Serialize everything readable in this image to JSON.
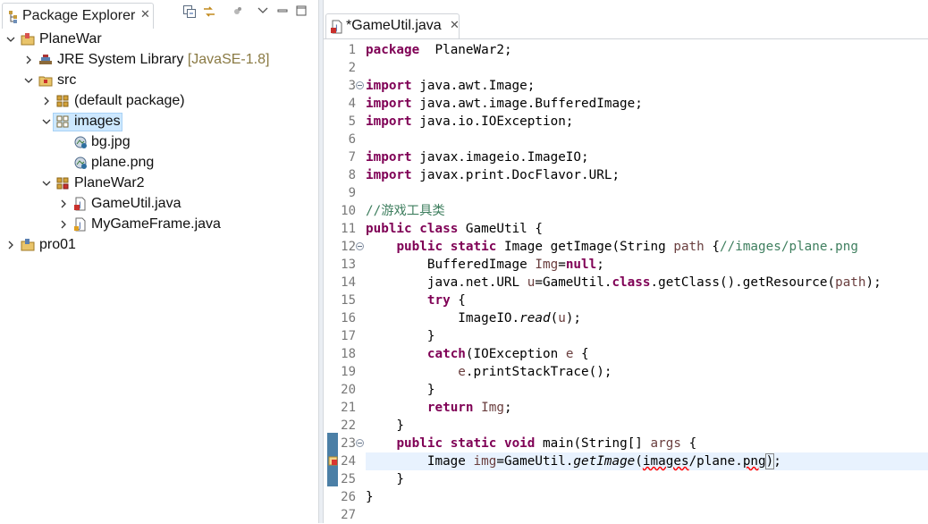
{
  "explorer": {
    "title": "Package Explorer",
    "tree": [
      {
        "label": "PlaneWar",
        "decoration": "",
        "icon": "project-icon",
        "expanded": true
      },
      {
        "label": "JRE System Library",
        "decoration": "[JavaSE-1.8]",
        "icon": "library-icon",
        "expanded": false
      },
      {
        "label": "src",
        "decoration": "",
        "icon": "source-folder-icon",
        "expanded": true
      },
      {
        "label": "(default package)",
        "decoration": "",
        "icon": "package-icon",
        "expanded": false
      },
      {
        "label": "images",
        "decoration": "",
        "icon": "package-icon",
        "expanded": true,
        "selected": true
      },
      {
        "label": "bg.jpg",
        "decoration": "",
        "icon": "image-file-icon"
      },
      {
        "label": "plane.png",
        "decoration": "",
        "icon": "image-file-icon"
      },
      {
        "label": "PlaneWar2",
        "decoration": "",
        "icon": "package-icon",
        "expanded": true
      },
      {
        "label": "GameUtil.java",
        "decoration": "",
        "icon": "java-file-icon",
        "expanded": false
      },
      {
        "label": "MyGameFrame.java",
        "decoration": "",
        "icon": "java-file-icon",
        "expanded": false
      },
      {
        "label": "pro01",
        "decoration": "",
        "icon": "project-icon",
        "expanded": false
      }
    ]
  },
  "editor": {
    "tab_title": "*GameUtil.java",
    "current_line": 24,
    "lines": [
      {
        "n": "1",
        "tokens": [
          [
            "kw",
            "package"
          ],
          [
            "",
            "  PlaneWar2;"
          ]
        ]
      },
      {
        "n": "2",
        "tokens": []
      },
      {
        "n": "3",
        "tokens": [
          [
            "kw",
            "import"
          ],
          [
            "",
            " java.awt.Image;"
          ]
        ]
      },
      {
        "n": "4",
        "tokens": [
          [
            "kw",
            "import"
          ],
          [
            "",
            " java.awt.image.BufferedImage;"
          ]
        ]
      },
      {
        "n": "5",
        "tokens": [
          [
            "kw",
            "import"
          ],
          [
            "",
            " java.io.IOException;"
          ]
        ]
      },
      {
        "n": "6",
        "tokens": []
      },
      {
        "n": "7",
        "tokens": [
          [
            "kw",
            "import"
          ],
          [
            "",
            " javax.imageio.ImageIO;"
          ]
        ]
      },
      {
        "n": "8",
        "tokens": [
          [
            "kw",
            "import"
          ],
          [
            "",
            " javax.print.DocFlavor.URL;"
          ]
        ]
      },
      {
        "n": "9",
        "tokens": []
      },
      {
        "n": "10",
        "tokens": [
          [
            "cm",
            "//游戏工具类"
          ]
        ]
      },
      {
        "n": "11",
        "tokens": [
          [
            "kw",
            "public"
          ],
          [
            "",
            " "
          ],
          [
            "kw",
            "class"
          ],
          [
            "",
            " GameUtil {"
          ]
        ]
      },
      {
        "n": "12",
        "tokens": [
          [
            "",
            "    "
          ],
          [
            "kw",
            "public"
          ],
          [
            "",
            " "
          ],
          [
            "kw",
            "static"
          ],
          [
            "",
            " Image getImage(String "
          ],
          [
            "pv",
            "path"
          ],
          [
            "",
            " {"
          ],
          [
            "cm",
            "//images/plane.png"
          ]
        ]
      },
      {
        "n": "13",
        "tokens": [
          [
            "",
            "        BufferedImage "
          ],
          [
            "pv",
            "Img"
          ],
          [
            "",
            "="
          ],
          [
            "kw",
            "null"
          ],
          [
            "",
            ";"
          ]
        ]
      },
      {
        "n": "14",
        "tokens": [
          [
            "",
            "        java.net.URL "
          ],
          [
            "pv",
            "u"
          ],
          [
            "",
            "=GameUtil."
          ],
          [
            "kw",
            "class"
          ],
          [
            "",
            ".getClass().getResource("
          ],
          [
            "pv",
            "path"
          ],
          [
            "",
            ");"
          ]
        ]
      },
      {
        "n": "15",
        "tokens": [
          [
            "",
            "        "
          ],
          [
            "kw",
            "try"
          ],
          [
            "",
            " {"
          ]
        ]
      },
      {
        "n": "16",
        "tokens": [
          [
            "",
            "            ImageIO."
          ],
          [
            "it",
            "read"
          ],
          [
            "",
            "("
          ],
          [
            "pv",
            "u"
          ],
          [
            "",
            ");"
          ]
        ]
      },
      {
        "n": "17",
        "tokens": [
          [
            "",
            "        }"
          ]
        ]
      },
      {
        "n": "18",
        "tokens": [
          [
            "",
            "        "
          ],
          [
            "kw",
            "catch"
          ],
          [
            "",
            "(IOException "
          ],
          [
            "pv",
            "e"
          ],
          [
            "",
            " {"
          ]
        ]
      },
      {
        "n": "19",
        "tokens": [
          [
            "",
            "            "
          ],
          [
            "pv",
            "e"
          ],
          [
            "",
            ".printStackTrace();"
          ]
        ]
      },
      {
        "n": "20",
        "tokens": [
          [
            "",
            "        }"
          ]
        ]
      },
      {
        "n": "21",
        "tokens": [
          [
            "",
            "        "
          ],
          [
            "kw",
            "return"
          ],
          [
            "",
            " "
          ],
          [
            "pv",
            "Img"
          ],
          [
            "",
            ";"
          ]
        ]
      },
      {
        "n": "22",
        "tokens": [
          [
            "",
            "    }"
          ]
        ]
      },
      {
        "n": "23",
        "tokens": [
          [
            "",
            "    "
          ],
          [
            "kw",
            "public"
          ],
          [
            "",
            " "
          ],
          [
            "kw",
            "static"
          ],
          [
            "",
            " "
          ],
          [
            "kw",
            "void"
          ],
          [
            "",
            " main(String[] "
          ],
          [
            "pv",
            "args"
          ],
          [
            "",
            " {"
          ]
        ]
      },
      {
        "n": "24",
        "tokens": [
          [
            "",
            "        Image "
          ],
          [
            "pv",
            "img"
          ],
          [
            "",
            "=GameUtil."
          ],
          [
            "it",
            "getImage"
          ],
          [
            "",
            "("
          ],
          [
            "err",
            "images"
          ],
          [
            "",
            "/plane."
          ],
          [
            "err",
            "png"
          ],
          [
            "bracket",
            ")"
          ],
          [
            "",
            ";"
          ]
        ]
      },
      {
        "n": "25",
        "tokens": [
          [
            "",
            "    }"
          ]
        ]
      },
      {
        "n": "26",
        "tokens": [
          [
            "",
            "}"
          ]
        ]
      },
      {
        "n": "27",
        "tokens": []
      }
    ]
  }
}
